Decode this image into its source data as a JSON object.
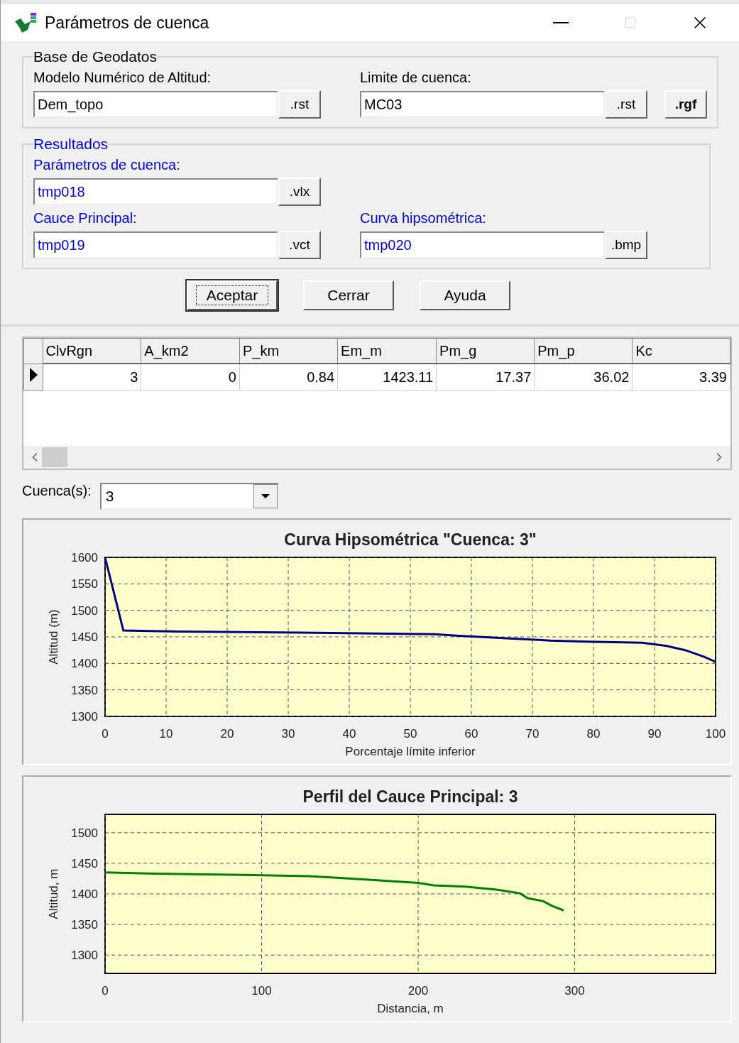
{
  "window": {
    "title": "Parámetros de cuenca"
  },
  "groups": [
    {
      "title": "Base de Geodatos",
      "kind": "input",
      "rows": [
        [
          {
            "label": "Modelo Numérico de Altitud:",
            "value": "Dem_topo",
            "extension": ".rst"
          },
          {
            "label": "Limite de cuenca:",
            "value": "MC03",
            "extension": ".rst",
            "extra_button": ".rgf"
          }
        ]
      ]
    },
    {
      "title": "Resultados",
      "kind": "output",
      "rows": [
        [
          {
            "label": "Parámetros de cuenca:",
            "value": "tmp018",
            "extension": ".vlx"
          }
        ],
        [
          {
            "label": "Cauce Principal:",
            "value": "tmp019",
            "extension": ".vct"
          },
          {
            "label": "Curva hipsométrica:",
            "value": "tmp020",
            "extension": ".bmp"
          }
        ]
      ]
    }
  ],
  "buttons": [
    {
      "label": "Aceptar",
      "focused": true
    },
    {
      "label": "Cerrar",
      "focused": false
    },
    {
      "label": "Ayuda",
      "focused": false
    }
  ],
  "table": {
    "columns": [
      "ClvRgn",
      "A_km2",
      "P_km",
      "Em_m",
      "Pm_g",
      "Pm_p",
      "Kc"
    ],
    "rows": [
      {
        "selected": true,
        "cells": [
          "3",
          "0",
          "0.84",
          "1423.11",
          "17.37",
          "36.02",
          "3.39"
        ]
      }
    ]
  },
  "basin_select": {
    "label": "Cuenca(s):",
    "value": "3"
  },
  "charts": [
    {
      "chart_data": {
        "type": "line",
        "title": "Curva Hipsométrica \"Cuenca: 3\"",
        "xlabel": "Porcentaje límite inferior",
        "ylabel": "Altitud (m)",
        "xlim": [
          0,
          100
        ],
        "ylim": [
          1300,
          1600
        ],
        "xticks": [
          0,
          10,
          20,
          30,
          40,
          50,
          60,
          70,
          80,
          90,
          100
        ],
        "yticks": [
          1300,
          1350,
          1400,
          1450,
          1500,
          1550,
          1600
        ],
        "x": [
          0,
          3,
          12,
          32,
          54,
          58,
          63,
          68,
          73,
          79,
          88,
          92,
          95,
          98,
          100
        ],
        "grid": true,
        "series": [
          {
            "color": "#000080",
            "values": [
              1600,
              1462,
              1460,
              1458,
              1455,
              1452,
              1449,
              1446,
              1443,
              1441,
              1439,
              1433,
              1425,
              1413,
              1403
            ]
          }
        ]
      }
    },
    {
      "chart_data": {
        "type": "line",
        "title": "Perfil del Cauce Principal: 3",
        "xlabel": "Distancia, m",
        "ylabel": "Altitud, m",
        "xlim": [
          0,
          390
        ],
        "ylim": [
          1270,
          1530
        ],
        "xticks": [
          0,
          100,
          200,
          300
        ],
        "yticks": [
          1300,
          1350,
          1400,
          1450,
          1500
        ],
        "x": [
          0,
          32,
          88,
          130,
          150,
          170,
          200,
          210,
          230,
          250,
          265,
          270,
          280,
          285,
          293
        ],
        "grid": true,
        "series": [
          {
            "color": "#008000",
            "values": [
              1435,
              1433,
              1431,
              1429,
              1426,
              1423,
              1418,
              1414,
              1412,
              1407,
              1401,
              1393,
              1388,
              1381,
              1373
            ]
          }
        ]
      }
    }
  ]
}
